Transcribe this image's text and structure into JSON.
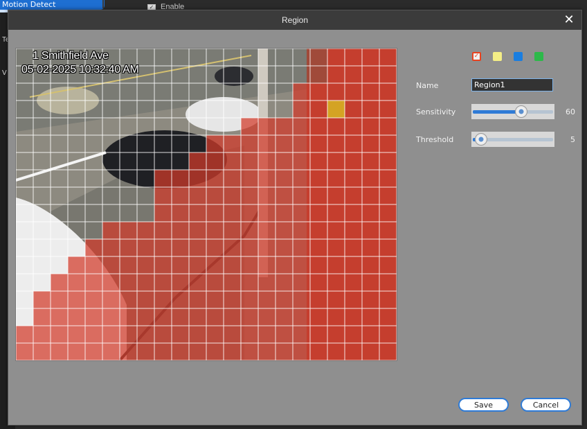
{
  "background": {
    "tab_label": "Motion Detect",
    "left_items": [
      "Te",
      "V"
    ],
    "enable_label": "Enable"
  },
  "dialog": {
    "title": "Region",
    "close_icon": "close-icon"
  },
  "preview": {
    "osd_line1": "1 Smithfield Ave",
    "osd_line2": "05-02-2025 10:32:40 AM",
    "grid_cols": 22,
    "grid_rows": 18,
    "grid_color": "#ffffff",
    "mask_color": "#d23a2a",
    "highlight_color": "#e6c21c",
    "masked_fraction_note": ""
  },
  "region_colors": [
    {
      "name": "red",
      "color": "#e8421f",
      "selected": true
    },
    {
      "name": "yellow",
      "color": "#f4ee86",
      "selected": false
    },
    {
      "name": "blue",
      "color": "#1a7ee0",
      "selected": false
    },
    {
      "name": "green",
      "color": "#2db94a",
      "selected": false
    }
  ],
  "form": {
    "name_label": "Name",
    "name_value": "Region1",
    "sensitivity_label": "Sensitivity",
    "sensitivity_value": "60",
    "sensitivity_fraction": 0.6,
    "threshold_label": "Threshold",
    "threshold_value": "5",
    "threshold_fraction": 0.1
  },
  "buttons": {
    "save": "Save",
    "cancel": "Cancel"
  }
}
